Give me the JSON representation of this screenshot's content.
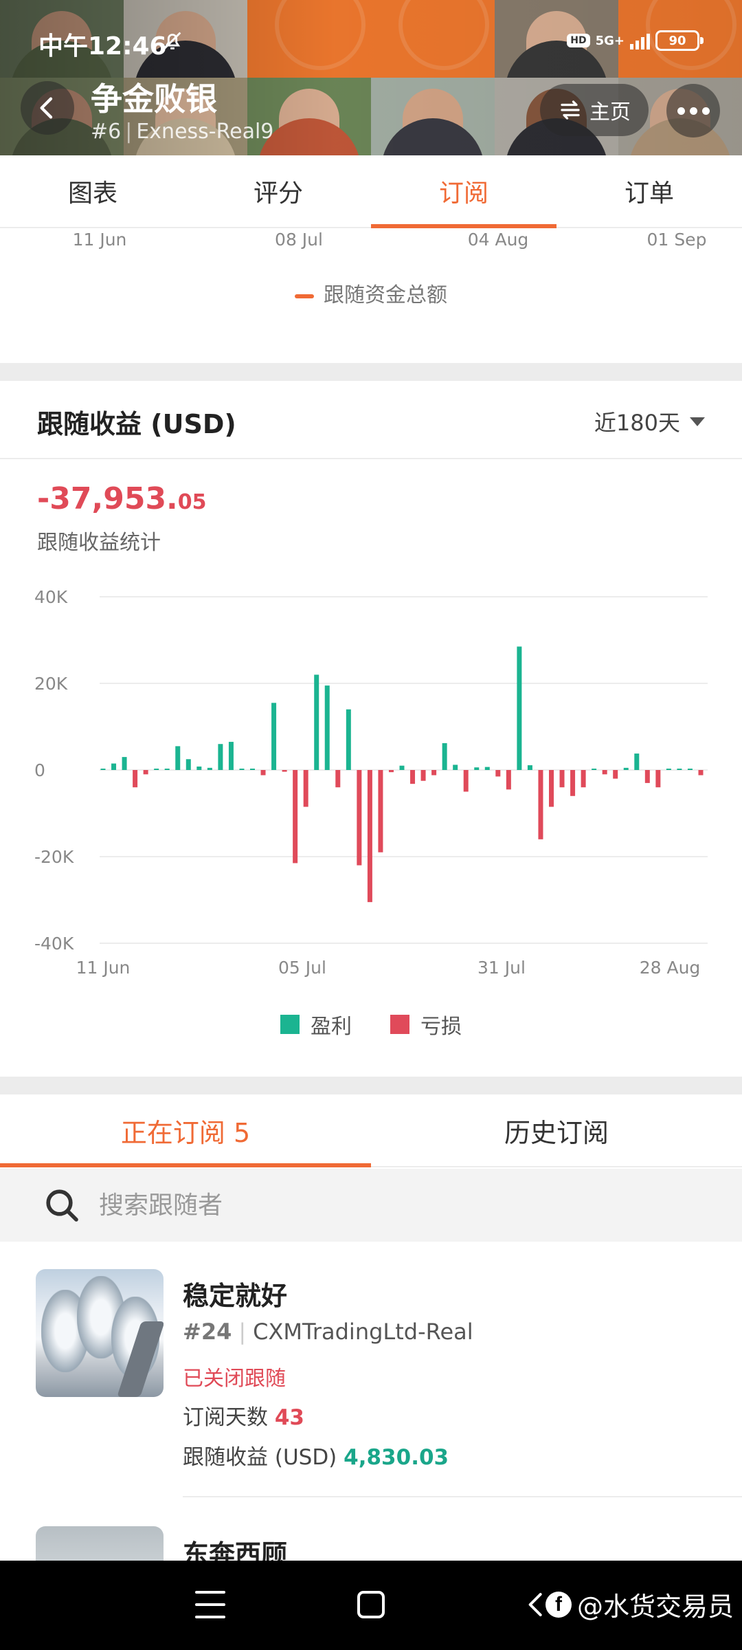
{
  "status_bar": {
    "time": "中午12:46",
    "hd": "HD",
    "network": "5G+",
    "battery": "90"
  },
  "header": {
    "trader_name": "争金败银",
    "rank": "#6",
    "account": "Exness-Real9",
    "home_label": "主页"
  },
  "tabs": [
    {
      "label": "图表",
      "active": false
    },
    {
      "label": "评分",
      "active": false
    },
    {
      "label": "订阅",
      "active": true
    },
    {
      "label": "订单",
      "active": false
    }
  ],
  "prev_chart": {
    "x_ticks": [
      "11 Jun",
      "08 Jul",
      "04 Aug",
      "01 Sep"
    ],
    "legend": "跟随资金总额"
  },
  "profit_section": {
    "title": "跟随收益 (USD)",
    "period": "近180天",
    "total_int": "-37,953.",
    "total_dec": "05",
    "total_label": "跟随收益统计"
  },
  "chart_data": {
    "type": "bar",
    "title": "",
    "y_ticks": [
      "40K",
      "20K",
      "0",
      "-20K",
      "-40K"
    ],
    "ylim": [
      -40000,
      40000
    ],
    "x_ticks": [
      "11 Jun",
      "05 Jul",
      "31 Jul",
      "28 Aug"
    ],
    "grid": true,
    "legend_position": "bottom",
    "series": [
      {
        "name": "盈利",
        "color": "#1bb491"
      },
      {
        "name": "亏损",
        "color": "#e04a5a"
      }
    ],
    "values": [
      0,
      1500,
      3000,
      -4000,
      -1000,
      0,
      0,
      5500,
      2500,
      800,
      500,
      6000,
      6500,
      200,
      0,
      -1200,
      15500,
      -400,
      -21500,
      -8500,
      22000,
      19500,
      -4000,
      14000,
      -22000,
      -30500,
      -19000,
      -500,
      1000,
      -3200,
      -2500,
      -1200,
      6200,
      1200,
      -5000,
      600,
      700,
      -1500,
      -4500,
      28500,
      1100,
      -16000,
      -8500,
      -4000,
      -6000,
      -4000,
      0,
      -1000,
      -2000,
      500,
      3800,
      -3000,
      -4000,
      0,
      0,
      0,
      -1200
    ]
  },
  "chart_legend": {
    "profit": "盈利",
    "loss": "亏损"
  },
  "sub_tabs": [
    {
      "label": "正在订阅 5",
      "active": true
    },
    {
      "label": "历史订阅",
      "active": false
    }
  ],
  "search": {
    "placeholder": "搜索跟随者"
  },
  "followers": [
    {
      "name": "稳定就好",
      "rank": "#24",
      "account": "CXMTradingLtd-Real",
      "status": "已关闭跟随",
      "days_label": "订阅天数",
      "days": "43",
      "profit_label": "跟随收益 (USD)",
      "profit": "4,830.03"
    },
    {
      "name": "东奔西顾"
    }
  ],
  "watermark": "@水货交易员",
  "colors": {
    "accent": "#f06a35",
    "profit": "#1bb491",
    "loss": "#e04a5a"
  }
}
